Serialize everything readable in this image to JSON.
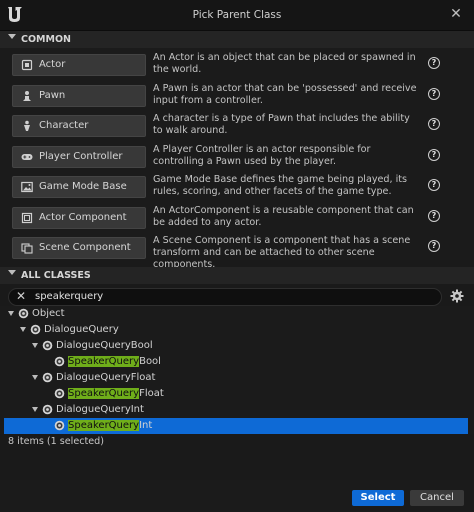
{
  "window": {
    "title": "Pick Parent Class"
  },
  "common": {
    "header": "COMMON",
    "items": [
      {
        "label": "Actor",
        "icon": "actor-icon",
        "description": "An Actor is an object that can be placed or spawned in the world."
      },
      {
        "label": "Pawn",
        "icon": "pawn-icon",
        "description": "A Pawn is an actor that can be 'possessed' and receive input from a controller."
      },
      {
        "label": "Character",
        "icon": "character-icon",
        "description": "A character is a type of Pawn that includes the ability to walk around."
      },
      {
        "label": "Player Controller",
        "icon": "gamepad-icon",
        "description": "A Player Controller is an actor responsible for controlling a Pawn used by the player."
      },
      {
        "label": "Game Mode Base",
        "icon": "image-icon",
        "description": "Game Mode Base defines the game being played, its rules, scoring, and other facets of the game type."
      },
      {
        "label": "Actor Component",
        "icon": "component-icon",
        "description": "An ActorComponent is a reusable component that can be added to any actor."
      },
      {
        "label": "Scene Component",
        "icon": "scene-component-icon",
        "description": "A Scene Component is a component that has a scene transform and can be attached to other scene components."
      }
    ]
  },
  "all_classes": {
    "header": "ALL CLASSES",
    "search_value": "speakerquery",
    "tree": [
      {
        "text": "Object",
        "match": "",
        "rest": "",
        "indent": 0,
        "expanded": true,
        "selected": false
      },
      {
        "text": "DialogueQuery",
        "match": "",
        "rest": "",
        "indent": 1,
        "expanded": true,
        "selected": false
      },
      {
        "text": "DialogueQueryBool",
        "match": "",
        "rest": "",
        "indent": 2,
        "expanded": true,
        "selected": false
      },
      {
        "text": "",
        "match": "SpeakerQuery",
        "rest": "Bool",
        "indent": 3,
        "expanded": null,
        "selected": false
      },
      {
        "text": "DialogueQueryFloat",
        "match": "",
        "rest": "",
        "indent": 2,
        "expanded": true,
        "selected": false
      },
      {
        "text": "",
        "match": "SpeakerQuery",
        "rest": "Float",
        "indent": 3,
        "expanded": null,
        "selected": false
      },
      {
        "text": "DialogueQueryInt",
        "match": "",
        "rest": "",
        "indent": 2,
        "expanded": true,
        "selected": false
      },
      {
        "text": "",
        "match": "SpeakerQuery",
        "rest": "Int",
        "indent": 3,
        "expanded": null,
        "selected": true
      }
    ],
    "status": "8 items (1 selected)"
  },
  "buttons": {
    "select": "Select",
    "cancel": "Cancel"
  },
  "colors": {
    "accent": "#0e6ad6",
    "highlight": "#6fae1a",
    "background": "#1a1a1a"
  }
}
